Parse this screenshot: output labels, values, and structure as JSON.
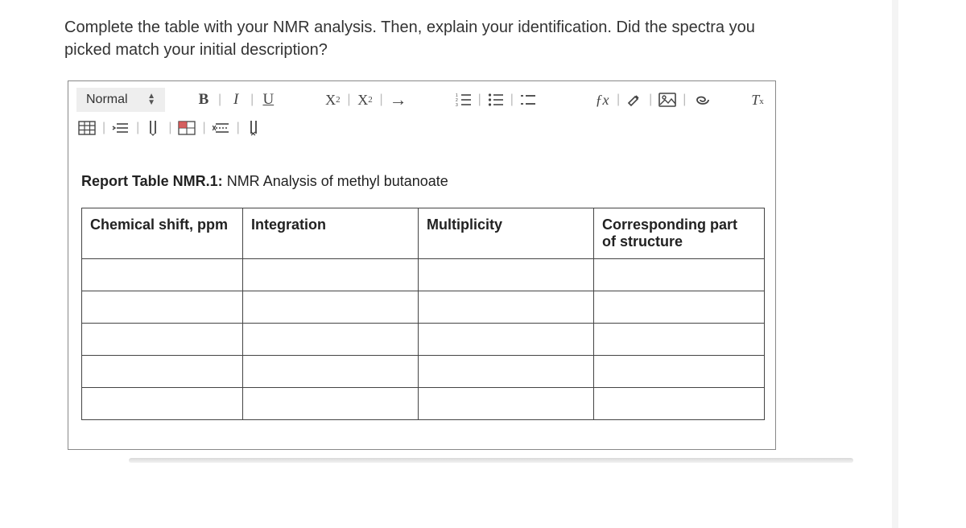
{
  "question": "Complete the table with your NMR analysis. Then, explain your identification. Did the spectra you picked match your initial description?",
  "toolbar": {
    "style_selector": "Normal",
    "bold": "B",
    "italic": "I",
    "underline": "U",
    "subscript": "X",
    "subscript_sub": "2",
    "superscript": "X",
    "superscript_sup": "2",
    "arrow": "→",
    "fx": "ƒx",
    "clear_format": "T",
    "clear_format_sub": "x"
  },
  "content": {
    "report_title_bold": "Report Table NMR.1:",
    "report_title_rest": " NMR Analysis of methyl butanoate",
    "headers": {
      "col1": "Chemical shift, ppm",
      "col2": "Integration",
      "col3": "Multiplicity",
      "col4_l1": "Corresponding part",
      "col4_l2": "of structure"
    }
  }
}
